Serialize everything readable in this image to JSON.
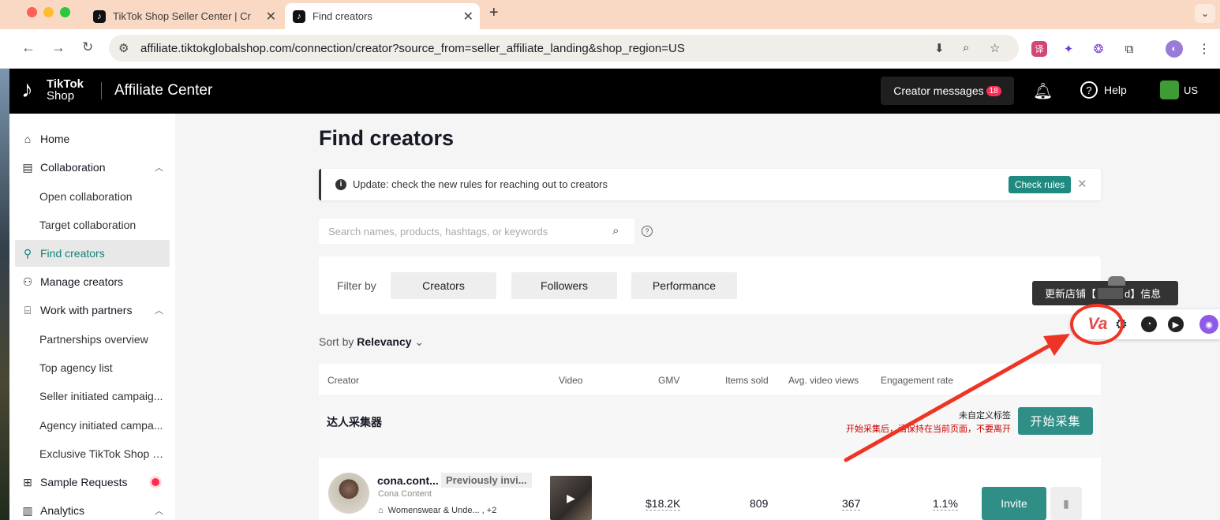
{
  "browser": {
    "tabs": [
      {
        "title": "TikTok Shop Seller Center | Cr",
        "close": "✕"
      },
      {
        "title": "Find creators",
        "close": "✕"
      }
    ],
    "new_tab": "+",
    "tab_menu": "⌄",
    "url": "affiliate.tiktokglobalshop.com/connection/creator?source_from=seller_affiliate_landing&shop_region=US"
  },
  "header": {
    "logo_line1": "TikTok",
    "logo_line2": "Shop",
    "app_title": "Affiliate Center",
    "messages_label": "Creator messages",
    "messages_count": "18",
    "help_label": "Help",
    "region": "US"
  },
  "sidebar": {
    "items": [
      {
        "label": "Home",
        "icon": "home-icon"
      },
      {
        "label": "Collaboration",
        "icon": "collaboration-icon"
      },
      {
        "label": "Open collaboration"
      },
      {
        "label": "Target collaboration"
      },
      {
        "label": "Find creators",
        "icon": "find-creators-icon"
      },
      {
        "label": "Manage creators",
        "icon": "manage-creators-icon"
      },
      {
        "label": "Work with partners",
        "icon": "partners-icon"
      },
      {
        "label": "Partnerships overview"
      },
      {
        "label": "Top agency list"
      },
      {
        "label": "Seller initiated campaig..."
      },
      {
        "label": "Agency initiated campa..."
      },
      {
        "label": "Exclusive TikTok Shop c..."
      },
      {
        "label": "Sample Requests",
        "icon": "gift-icon"
      },
      {
        "label": "Analytics",
        "icon": "analytics-icon"
      }
    ]
  },
  "main": {
    "page_title": "Find creators",
    "notice": {
      "text": "Update: check the new rules for reaching out to creators",
      "button": "Check rules"
    },
    "search": {
      "placeholder": "Search names, products, hashtags, or keywords"
    },
    "filter": {
      "label": "Filter by",
      "buttons": [
        "Creators",
        "Followers",
        "Performance"
      ]
    },
    "sort": {
      "label": "Sort by",
      "value": "Relevancy"
    },
    "table": {
      "headers": [
        "Creator",
        "Video",
        "GMV",
        "Items sold",
        "Avg. video views",
        "Engagement rate"
      ],
      "collector": {
        "title": "达人采集器",
        "tag": "未自定义标签",
        "warning": "开始采集后，请保持在当前页面，不要离开",
        "button": "开始采集"
      },
      "rows": [
        {
          "handle": "cona.cont...",
          "status": "Previously invi...",
          "name": "Cona Content",
          "category": "Womenswear & Unde... , +2",
          "gmv": "$18.2K",
          "items_sold": "809",
          "avg_views": "367",
          "engagement": "1.1%",
          "action": "Invite"
        }
      ]
    }
  },
  "overlay": {
    "tooltip_prefix": "更新店铺【",
    "tooltip_suffix": "d】信息",
    "widget_logo": "Va"
  },
  "colors": {
    "accent": "#2f8f86",
    "badge": "#fe2c55",
    "annotation": "#ee3424"
  }
}
